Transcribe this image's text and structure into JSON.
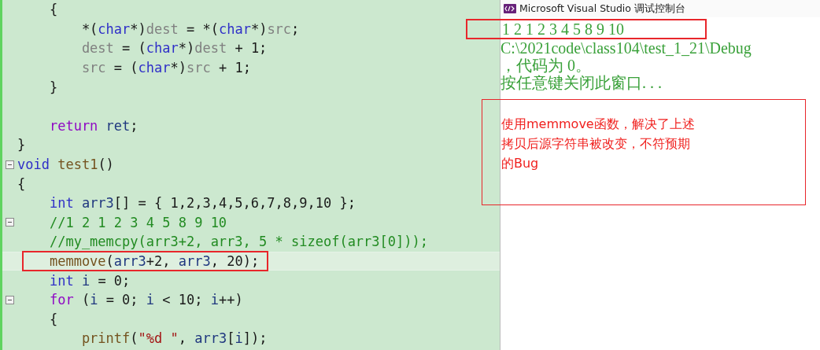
{
  "editor": {
    "lines": [
      {
        "tokens": [
          {
            "kind": "plain",
            "text": "    {"
          }
        ],
        "collapsible": false,
        "current": false,
        "boxed": false
      },
      {
        "tokens": [
          {
            "kind": "plain",
            "text": "        *("
          },
          {
            "kind": "keyword",
            "text": "char"
          },
          {
            "kind": "plain",
            "text": "*)"
          },
          {
            "kind": "param",
            "text": "dest"
          },
          {
            "kind": "plain",
            "text": " = *("
          },
          {
            "kind": "keyword",
            "text": "char"
          },
          {
            "kind": "plain",
            "text": "*)"
          },
          {
            "kind": "param",
            "text": "src"
          },
          {
            "kind": "plain",
            "text": ";"
          }
        ],
        "collapsible": false,
        "current": false,
        "boxed": false
      },
      {
        "tokens": [
          {
            "kind": "param",
            "text": "        dest"
          },
          {
            "kind": "plain",
            "text": " = ("
          },
          {
            "kind": "keyword",
            "text": "char"
          },
          {
            "kind": "plain",
            "text": "*)"
          },
          {
            "kind": "param",
            "text": "dest"
          },
          {
            "kind": "plain",
            "text": " + 1;"
          }
        ],
        "collapsible": false,
        "current": false,
        "boxed": false
      },
      {
        "tokens": [
          {
            "kind": "param",
            "text": "        src"
          },
          {
            "kind": "plain",
            "text": " = ("
          },
          {
            "kind": "keyword",
            "text": "char"
          },
          {
            "kind": "plain",
            "text": "*)"
          },
          {
            "kind": "param",
            "text": "src"
          },
          {
            "kind": "plain",
            "text": " + 1;"
          }
        ],
        "collapsible": false,
        "current": false,
        "boxed": false
      },
      {
        "tokens": [
          {
            "kind": "plain",
            "text": "    }"
          }
        ],
        "collapsible": false,
        "current": false,
        "boxed": false
      },
      {
        "collapsible": false,
        "boxed": false
      },
      {
        "tokens": [
          {
            "kind": "control",
            "text": "    return "
          },
          {
            "kind": "local",
            "text": "ret"
          },
          {
            "kind": "plain",
            "text": ";"
          }
        ],
        "collapsible": false,
        "current": false,
        "boxed": false
      },
      {
        "tokens": [
          {
            "kind": "plain",
            "text": "}"
          }
        ],
        "collapsible": false,
        "current": false,
        "boxed": false
      },
      {
        "tokens": [
          {
            "kind": "keyword",
            "text": "void "
          },
          {
            "kind": "function",
            "text": "test1"
          },
          {
            "kind": "plain",
            "text": "()"
          }
        ],
        "collapsible": true,
        "current": false,
        "boxed": false
      },
      {
        "tokens": [
          {
            "kind": "plain",
            "text": "{"
          }
        ],
        "collapsible": false,
        "current": false,
        "boxed": false
      },
      {
        "tokens": [
          {
            "kind": "keyword",
            "text": "    int "
          },
          {
            "kind": "local",
            "text": "arr3"
          },
          {
            "kind": "plain",
            "text": "[] = { 1,2,3,4,5,6,7,8,9,10 };"
          }
        ],
        "collapsible": false,
        "current": false,
        "boxed": false
      },
      {
        "tokens": [
          {
            "kind": "comment",
            "text": "    //1 2 1 2 3 4 5 8 9 10"
          }
        ],
        "collapsible": true,
        "current": false,
        "boxed": false
      },
      {
        "tokens": [
          {
            "kind": "comment",
            "text": "    //my_memcpy(arr3+2, arr3, 5 * sizeof(arr3[0]));"
          }
        ],
        "collapsible": false,
        "current": false,
        "boxed": false
      },
      {
        "tokens": [
          {
            "kind": "function",
            "text": "    memmove"
          },
          {
            "kind": "plain",
            "text": "("
          },
          {
            "kind": "local",
            "text": "arr3"
          },
          {
            "kind": "plain",
            "text": "+2, "
          },
          {
            "kind": "local",
            "text": "arr3"
          },
          {
            "kind": "plain",
            "text": ", 20);"
          }
        ],
        "collapsible": false,
        "current": true,
        "boxed": true
      },
      {
        "tokens": [
          {
            "kind": "keyword",
            "text": "    int "
          },
          {
            "kind": "local",
            "text": "i"
          },
          {
            "kind": "plain",
            "text": " = 0;"
          }
        ],
        "collapsible": false,
        "current": false,
        "boxed": false
      },
      {
        "tokens": [
          {
            "kind": "control",
            "text": "    for"
          },
          {
            "kind": "plain",
            "text": " ("
          },
          {
            "kind": "local",
            "text": "i"
          },
          {
            "kind": "plain",
            "text": " = 0; "
          },
          {
            "kind": "local",
            "text": "i"
          },
          {
            "kind": "plain",
            "text": " < 10; "
          },
          {
            "kind": "local",
            "text": "i"
          },
          {
            "kind": "plain",
            "text": "++)"
          }
        ],
        "collapsible": true,
        "current": false,
        "boxed": false
      },
      {
        "tokens": [
          {
            "kind": "plain",
            "text": "    {"
          }
        ],
        "collapsible": false,
        "current": false,
        "boxed": false
      },
      {
        "tokens": [
          {
            "kind": "function",
            "text": "        printf"
          },
          {
            "kind": "plain",
            "text": "("
          },
          {
            "kind": "string",
            "text": "\"%d \""
          },
          {
            "kind": "plain",
            "text": ", "
          },
          {
            "kind": "local",
            "text": "arr3"
          },
          {
            "kind": "plain",
            "text": "["
          },
          {
            "kind": "local",
            "text": "i"
          },
          {
            "kind": "plain",
            "text": "]);"
          }
        ],
        "collapsible": false,
        "current": false,
        "boxed": false
      }
    ]
  },
  "console": {
    "title": "Microsoft Visual Studio 调试控制台",
    "output": [
      {
        "text": "1 2 1 2 3 4 5 8 9 10",
        "boxed": true
      },
      {
        "text": "C:\\2021code\\class104\\test_1_21\\Debug",
        "boxed": false
      },
      {
        "text": "，代码为 0。",
        "boxed": false
      },
      {
        "text": "按任意键关闭此窗口. . .",
        "boxed": false
      }
    ]
  },
  "note": {
    "lines": [
      "使用memmove函数，解决了上述",
      "拷贝后源字符串被改变，不符预期",
      "的Bug"
    ]
  }
}
